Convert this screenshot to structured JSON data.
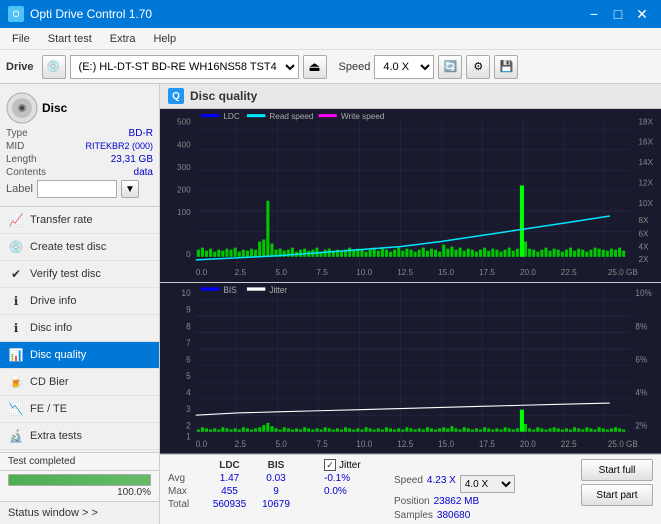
{
  "titleBar": {
    "title": "Opti Drive Control 1.70",
    "minimizeLabel": "−",
    "maximizeLabel": "□",
    "closeLabel": "✕"
  },
  "menuBar": {
    "items": [
      "File",
      "Start test",
      "Extra",
      "Help"
    ]
  },
  "toolbar": {
    "driveLabel": "Drive",
    "driveValue": "(E:) HL-DT-ST BD-RE  WH16NS58 TST4",
    "speedLabel": "Speed",
    "speedValue": "4.0 X"
  },
  "sidebar": {
    "disc": {
      "header": "Disc",
      "typeLabel": "Type",
      "typeValue": "BD-R",
      "midLabel": "MID",
      "midValue": "RITEKBR2 (000)",
      "lengthLabel": "Length",
      "lengthValue": "23,31 GB",
      "contentsLabel": "Contents",
      "contentsValue": "data",
      "labelLabel": "Label",
      "labelValue": ""
    },
    "navItems": [
      {
        "id": "transfer-rate",
        "label": "Transfer rate",
        "icon": "📈"
      },
      {
        "id": "create-test-disc",
        "label": "Create test disc",
        "icon": "💿"
      },
      {
        "id": "verify-test-disc",
        "label": "Verify test disc",
        "icon": "✔"
      },
      {
        "id": "drive-info",
        "label": "Drive info",
        "icon": "ℹ"
      },
      {
        "id": "disc-info",
        "label": "Disc info",
        "icon": "ℹ"
      },
      {
        "id": "disc-quality",
        "label": "Disc quality",
        "icon": "📊",
        "active": true
      },
      {
        "id": "cd-bier",
        "label": "CD Bier",
        "icon": "🍺"
      },
      {
        "id": "fe-te",
        "label": "FE / TE",
        "icon": "📉"
      },
      {
        "id": "extra-tests",
        "label": "Extra tests",
        "icon": "🔬"
      }
    ],
    "statusWindow": "Status window > >",
    "statusText": "Test completed",
    "progressValue": 100,
    "progressLabel": "100.0%"
  },
  "discQuality": {
    "title": "Disc quality",
    "legend": {
      "ldc": "LDC",
      "readSpeed": "Read speed",
      "writeSpeed": "Write speed"
    },
    "legend2": {
      "bis": "BIS",
      "jitter": "Jitter"
    },
    "stats": {
      "columns": [
        "",
        "LDC",
        "BIS",
        "",
        "Jitter"
      ],
      "rows": [
        {
          "label": "Avg",
          "ldc": "1.47",
          "bis": "0.03",
          "jitter": "-0.1%"
        },
        {
          "label": "Max",
          "ldc": "455",
          "bis": "9",
          "jitter": "0.0%"
        },
        {
          "label": "Total",
          "ldc": "560935",
          "bis": "10679",
          "jitter": ""
        }
      ],
      "speed": {
        "label": "Speed",
        "value": "4.23 X",
        "selectValue": "4.0 X"
      },
      "position": {
        "label": "Position",
        "value": "23862 MB"
      },
      "samples": {
        "label": "Samples",
        "value": "380680"
      }
    },
    "buttons": {
      "startFull": "Start full",
      "startPart": "Start part"
    }
  }
}
